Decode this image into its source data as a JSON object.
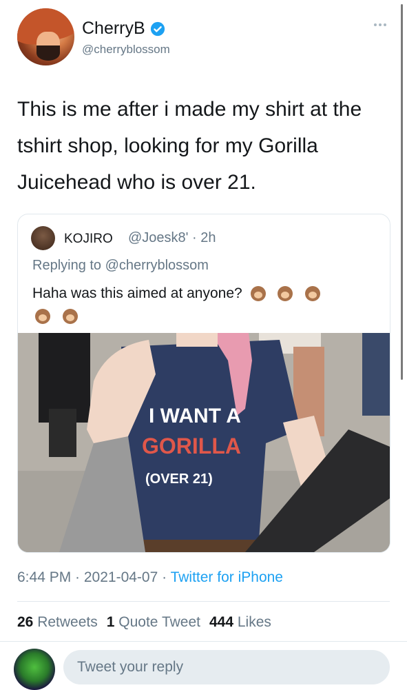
{
  "tweet": {
    "display_name": "CherryB",
    "handle": "@cherryblossom",
    "text": "This is me after i made my shirt at the tshirt shop, looking for my Gorilla Juicehead who is over 21.",
    "timestamp": "6:44 PM · 2021-04-07 · ",
    "source": "Twitter for iPhone"
  },
  "quote": {
    "display_name": "KOJIRO",
    "handle": "@Joesk8' · 2h",
    "reply_prefix": "Replying to ",
    "reply_to": "@cherryblossom",
    "text": "Haha was this aimed at anyone?",
    "image": {
      "shirt_line1": "I WANT A",
      "shirt_line2": "GORILLA",
      "shirt_line3": "(OVER 21)"
    }
  },
  "stats": {
    "retweets_count": "26",
    "retweets_label": "Retweets",
    "quotes_count": "1",
    "quotes_label": "Quote Tweet",
    "likes_count": "444",
    "likes_label": "Likes"
  },
  "reply": {
    "placeholder": "Tweet your reply"
  },
  "icons": {
    "verified": "verified-badge-icon",
    "more": "more-options-icon",
    "emoji": "monkey-emoji-icon"
  },
  "colors": {
    "accent": "#1da1f2",
    "secondary_text": "#657786",
    "border": "#e1e8ed"
  }
}
